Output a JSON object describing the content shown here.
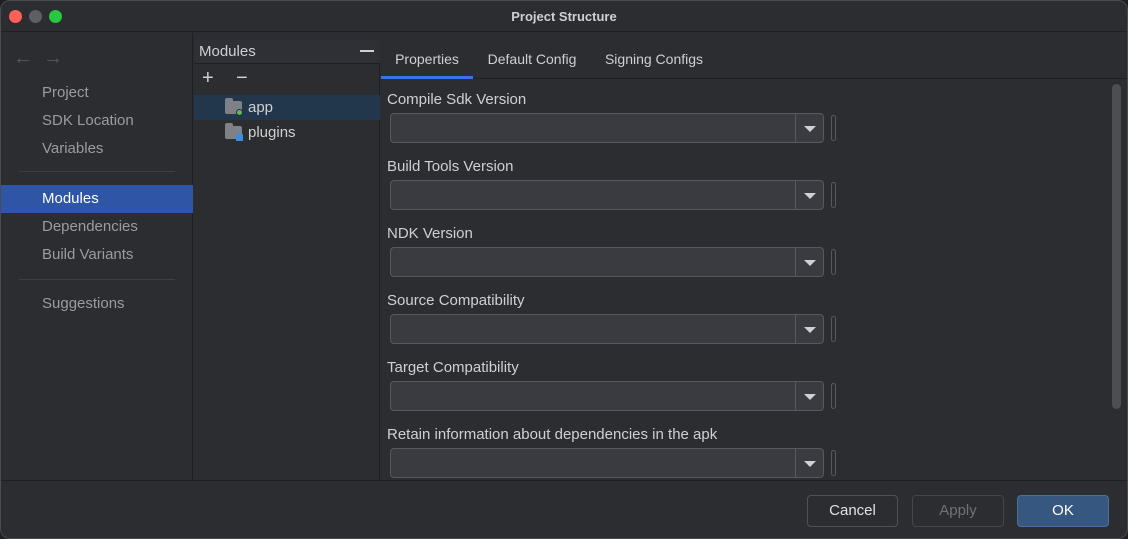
{
  "window": {
    "title": "Project Structure"
  },
  "nav": {
    "back": "←",
    "forward": "→"
  },
  "sidebar": {
    "items": [
      {
        "label": "Project"
      },
      {
        "label": "SDK Location"
      },
      {
        "label": "Variables"
      },
      {
        "label": "Modules",
        "selected": true
      },
      {
        "label": "Dependencies"
      },
      {
        "label": "Build Variants"
      },
      {
        "label": "Suggestions"
      }
    ]
  },
  "modules": {
    "header": "Modules",
    "add": "+",
    "remove": "−",
    "items": [
      {
        "label": "app",
        "selected": true,
        "icon": "folder-module-icon"
      },
      {
        "label": "plugins",
        "icon": "folder-library-icon"
      }
    ]
  },
  "tabs": [
    {
      "label": "Properties",
      "active": true
    },
    {
      "label": "Default Config"
    },
    {
      "label": "Signing Configs"
    }
  ],
  "fields": [
    {
      "label": "Compile Sdk Version",
      "value": ""
    },
    {
      "label": "Build Tools Version",
      "value": ""
    },
    {
      "label": "NDK Version",
      "value": ""
    },
    {
      "label": "Source Compatibility",
      "value": ""
    },
    {
      "label": "Target Compatibility",
      "value": ""
    },
    {
      "label": "Retain information about dependencies in the apk",
      "value": ""
    }
  ],
  "buttons": {
    "cancel": "Cancel",
    "apply": "Apply",
    "ok": "OK"
  },
  "colors": {
    "selection": "#2e55a6",
    "tab_underline": "#3574f0"
  }
}
